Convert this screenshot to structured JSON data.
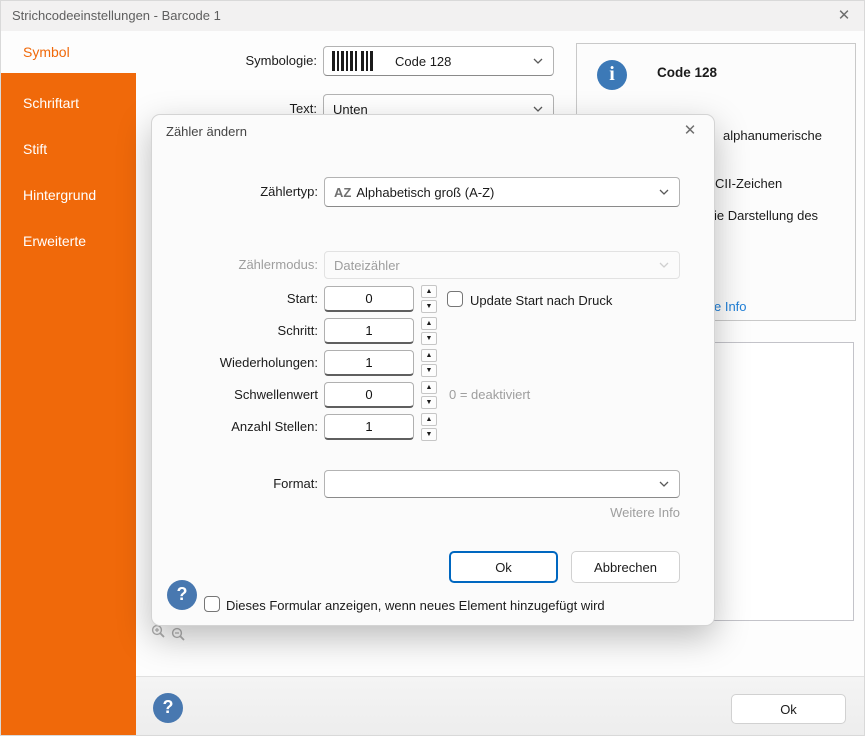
{
  "window": {
    "title": "Strichcodeeinstellungen - Barcode 1",
    "close_glyph": "✕"
  },
  "sidebar": {
    "items": [
      {
        "label": "Symbol",
        "selected": true
      },
      {
        "label": "Schriftart",
        "selected": false
      },
      {
        "label": "Stift",
        "selected": false
      },
      {
        "label": "Hintergrund",
        "selected": false
      },
      {
        "label": "Erweiterte",
        "selected": false
      }
    ]
  },
  "main": {
    "symbology": {
      "label": "Symbologie:",
      "value": "Code 128"
    },
    "text_position": {
      "label": "Text:",
      "value": "Unten"
    },
    "info_panel": {
      "title": "Code 128",
      "fragment_1": "alphanumerische",
      "fragment_2": "CII-Zeichen",
      "fragment_3": "ie Darstellung des",
      "link": "e Info"
    },
    "footer": {
      "ok_label": "Ok"
    }
  },
  "modal": {
    "title": "Zähler ändern",
    "close_glyph": "✕",
    "zaehlertyp": {
      "label": "Zählertyp:",
      "value_prefix": "AZ",
      "value": "Alphabetisch groß (A-Z)"
    },
    "zaehlermodus": {
      "label": "Zählermodus:",
      "value": "Dateizähler"
    },
    "start": {
      "label": "Start:",
      "value": "0",
      "checkbox_label": "Update Start nach Druck"
    },
    "schritt": {
      "label": "Schritt:",
      "value": "1"
    },
    "wiederholungen": {
      "label": "Wiederholungen:",
      "value": "1"
    },
    "schwellenwert": {
      "label": "Schwellenwert",
      "value": "0",
      "hint": "0 = deaktiviert"
    },
    "anzahl_stellen": {
      "label": "Anzahl Stellen:",
      "value": "1"
    },
    "format": {
      "label": "Format:",
      "value": "",
      "link": "Weitere Info"
    },
    "buttons": {
      "ok": "Ok",
      "cancel": "Abbrechen"
    },
    "footer_checkbox_label": "Dieses Formular anzeigen, wenn neues Element hinzugefügt wird",
    "spinner": {
      "up_glyph": "▲",
      "down_glyph": "▼"
    }
  },
  "icons": {
    "info_glyph": "i",
    "help_glyph": "?"
  },
  "colors": {
    "accent_orange": "#f0690a",
    "link_blue": "#2180d8",
    "ok_border_blue": "#0067c0",
    "info_icon_blue": "#3c79b7",
    "help_icon_blue": "#4878b0"
  }
}
